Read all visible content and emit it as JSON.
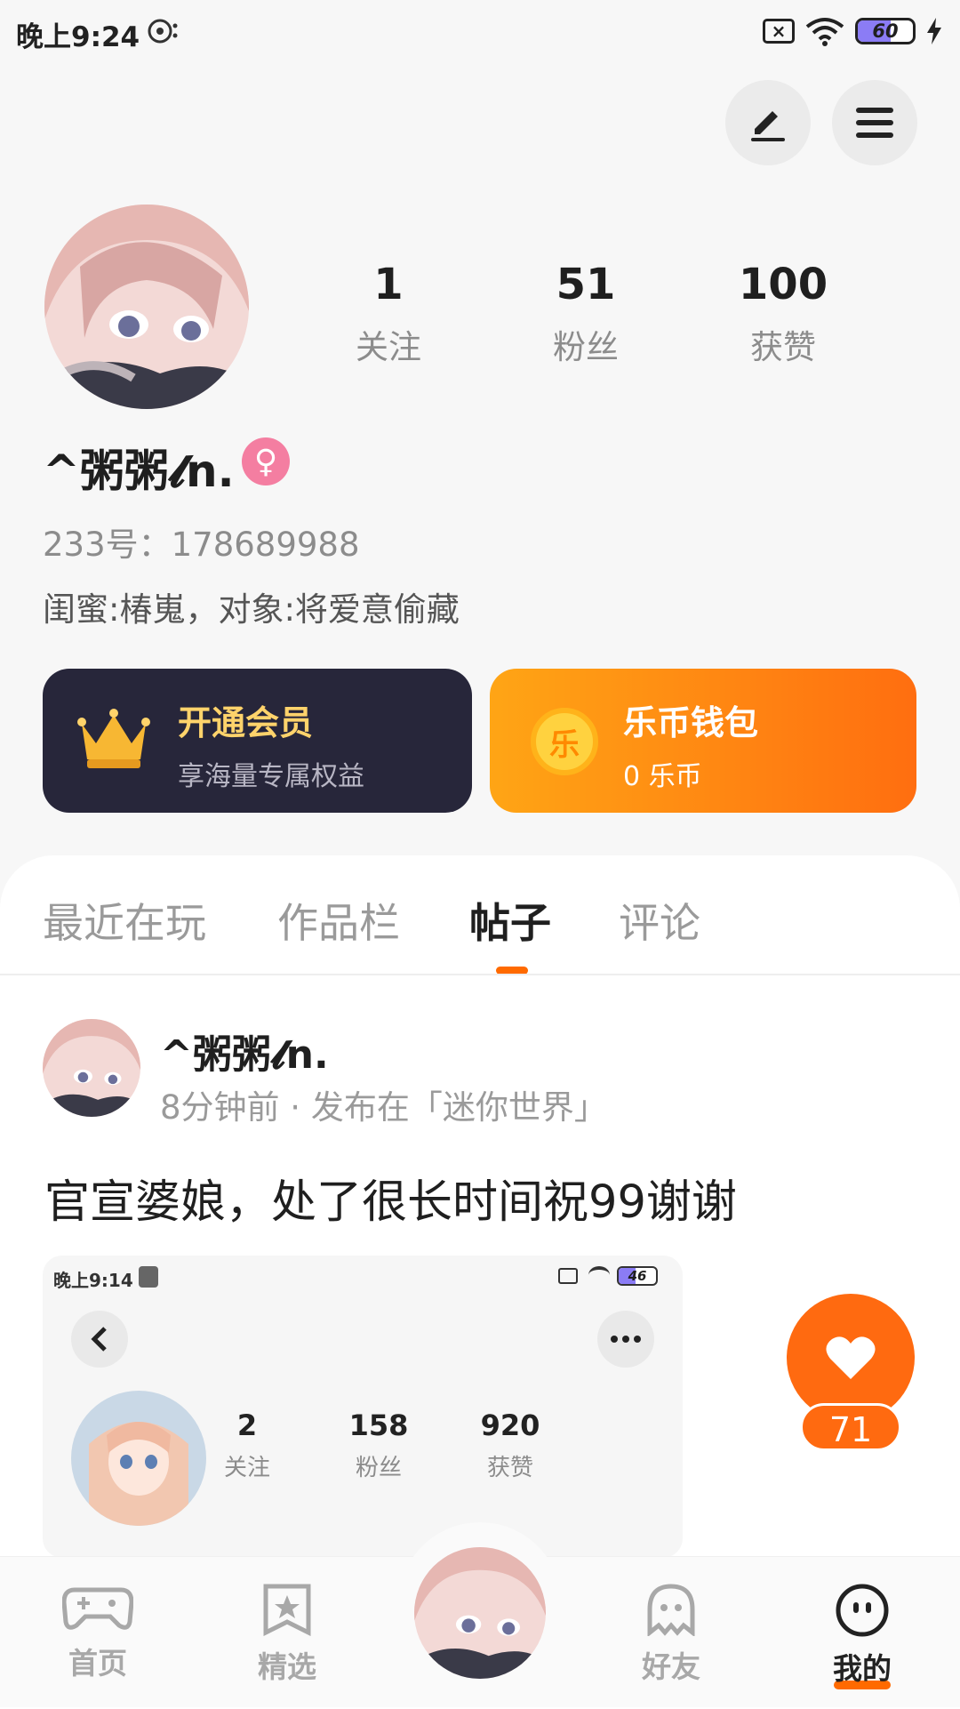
{
  "status_bar": {
    "time": "晚上9:24",
    "battery": "60",
    "battery_level": 0.6
  },
  "header": {
    "edit_icon": "pencil-icon",
    "menu_icon": "hamburger-menu-icon"
  },
  "profile": {
    "stats": [
      {
        "value": "1",
        "label": "关注"
      },
      {
        "value": "51",
        "label": "粉丝"
      },
      {
        "value": "100",
        "label": "获赞"
      }
    ],
    "username": "^粥粥𝓵n.",
    "gender_symbol": "♀",
    "uid": "233号：178689988",
    "bio": "闺蜜:椿嵬，对象:将爱意偷藏"
  },
  "cards": {
    "vip": {
      "title": "开通会员",
      "subtitle": "享海量专属权益"
    },
    "wallet": {
      "title": "乐币钱包",
      "subtitle": "0 乐币",
      "coin_char": "乐"
    }
  },
  "tabs": [
    {
      "label": "最近在玩",
      "active": false
    },
    {
      "label": "作品栏",
      "active": false
    },
    {
      "label": "帖子",
      "active": true
    },
    {
      "label": "评论",
      "active": false
    }
  ],
  "post": {
    "author": "^粥粥𝓵n.",
    "meta": "8分钟前 · 发布在「迷你世界」",
    "text": "官宣婆娘，处了很长时间祝99谢谢",
    "embedded_screenshot": {
      "time": "晚上9:14",
      "battery": "46",
      "battery_level": 0.46,
      "stats": [
        {
          "value": "2",
          "label": "关注"
        },
        {
          "value": "158",
          "label": "粉丝"
        },
        {
          "value": "920",
          "label": "获赞"
        }
      ]
    },
    "likes": "71"
  },
  "bottom_nav": [
    {
      "label": "首页",
      "icon": "gamepad-icon",
      "active": false
    },
    {
      "label": "精选",
      "icon": "star-bookmark-icon",
      "active": false
    },
    {
      "label": "好友",
      "icon": "ghost-icon",
      "active": false
    },
    {
      "label": "我的",
      "icon": "face-icon",
      "active": true
    }
  ],
  "colors": {
    "accent": "#ff6a00",
    "vip_card": "#27263a",
    "gold": "#ffd36b",
    "gender_badge": "#f47ea1"
  }
}
